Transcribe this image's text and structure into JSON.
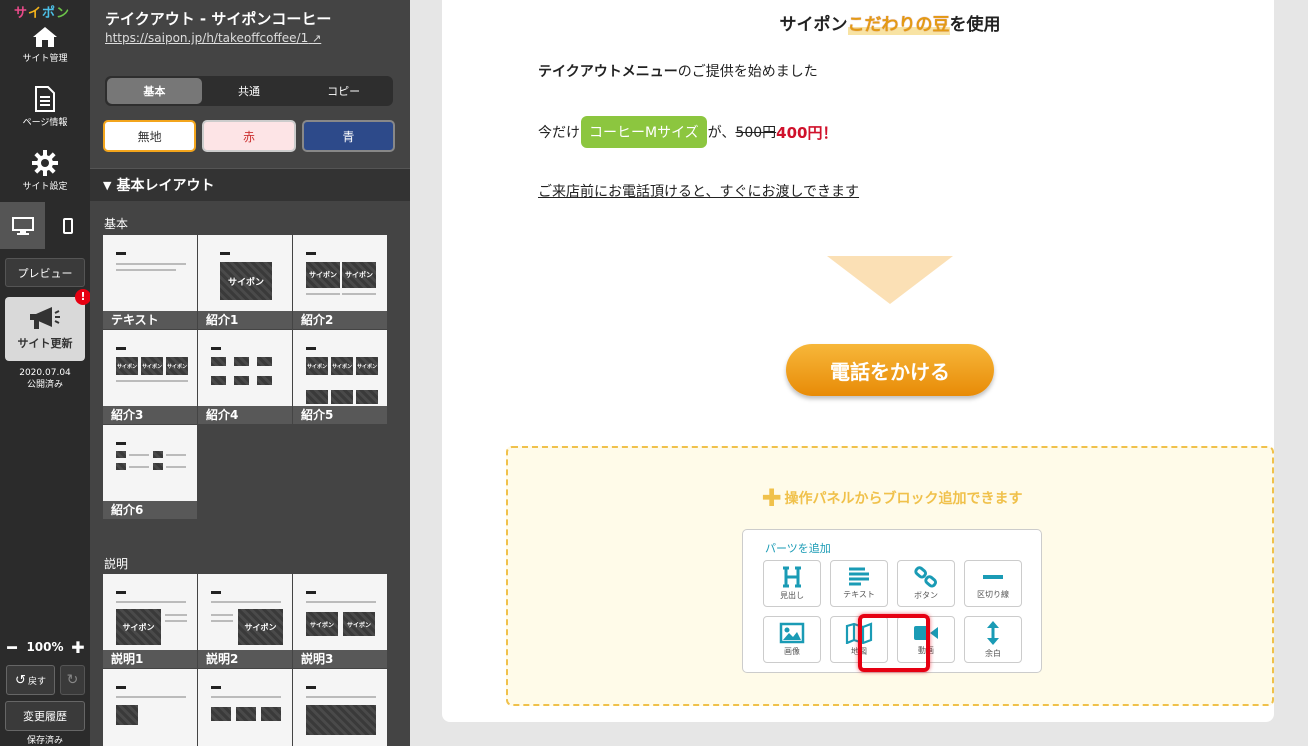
{
  "rail": {
    "logo": [
      "サ",
      "イ",
      "ポ",
      "ン"
    ],
    "items": [
      {
        "label": "サイト管理",
        "icon": "home-icon"
      },
      {
        "label": "ページ情報",
        "icon": "page-info-icon"
      },
      {
        "label": "サイト設定",
        "icon": "gear-icon"
      }
    ],
    "preview_label": "プレビュー",
    "update_label": "サイト更新",
    "update_badge": "!",
    "update_date": "2020.07.04",
    "update_status": "公開済み",
    "zoom": "100%",
    "undo_label": "戻す",
    "history_label": "変更履歴",
    "saved_label": "保存済み"
  },
  "panel": {
    "title": "テイクアウト - サイポンコーヒー",
    "url": "https://saipon.jp/h/takeoffcoffee/1",
    "tabs": [
      "基本",
      "共通",
      "コピー"
    ],
    "active_tab": "基本",
    "bg_options": [
      "無地",
      "赤",
      "青"
    ],
    "accordion_title": "基本レイアウト",
    "section_basic": "基本",
    "section_explain": "説明",
    "basic_tiles": [
      "テキスト",
      "紹介1",
      "紹介2",
      "紹介3",
      "紹介4",
      "紹介5",
      "紹介6"
    ],
    "explain_tiles": [
      "説明1",
      "説明2",
      "説明3"
    ],
    "thumb_text": "サイポン"
  },
  "canvas": {
    "heading_prefix": "サイポン",
    "heading_highlight": "こだわりの豆",
    "heading_suffix": "を使用",
    "line1_bold": "テイクアウトメニュー",
    "line1_rest": "のご提供を始めました",
    "line2_prefix": "今だけ",
    "line2_pill": "コーヒーMサイズ",
    "line2_mid": "が、",
    "line2_old_price": "500円",
    "line2_new_price": "400円！",
    "line3": "ご来店前にお電話頂けると、すぐにお渡しできます",
    "call_button": "電話をかける",
    "dropzone_message": "操作パネルからブロック追加できます",
    "parts_title": "パーツを追加",
    "parts": [
      {
        "label": "見出し",
        "icon": "heading-icon"
      },
      {
        "label": "テキスト",
        "icon": "text-icon"
      },
      {
        "label": "ボタン",
        "icon": "link-icon"
      },
      {
        "label": "区切り線",
        "icon": "divider-icon"
      },
      {
        "label": "画像",
        "icon": "image-icon"
      },
      {
        "label": "地図",
        "icon": "map-icon"
      },
      {
        "label": "動画",
        "icon": "video-icon"
      },
      {
        "label": "余白",
        "icon": "spacing-icon"
      }
    ]
  },
  "colors": {
    "accent": "#f0c14b",
    "pill": "#8cc63f",
    "price": "#d0112b",
    "call_button": "#e88b07",
    "highlight_box": "#e60012",
    "parts_icon": "#1a9bb5"
  }
}
